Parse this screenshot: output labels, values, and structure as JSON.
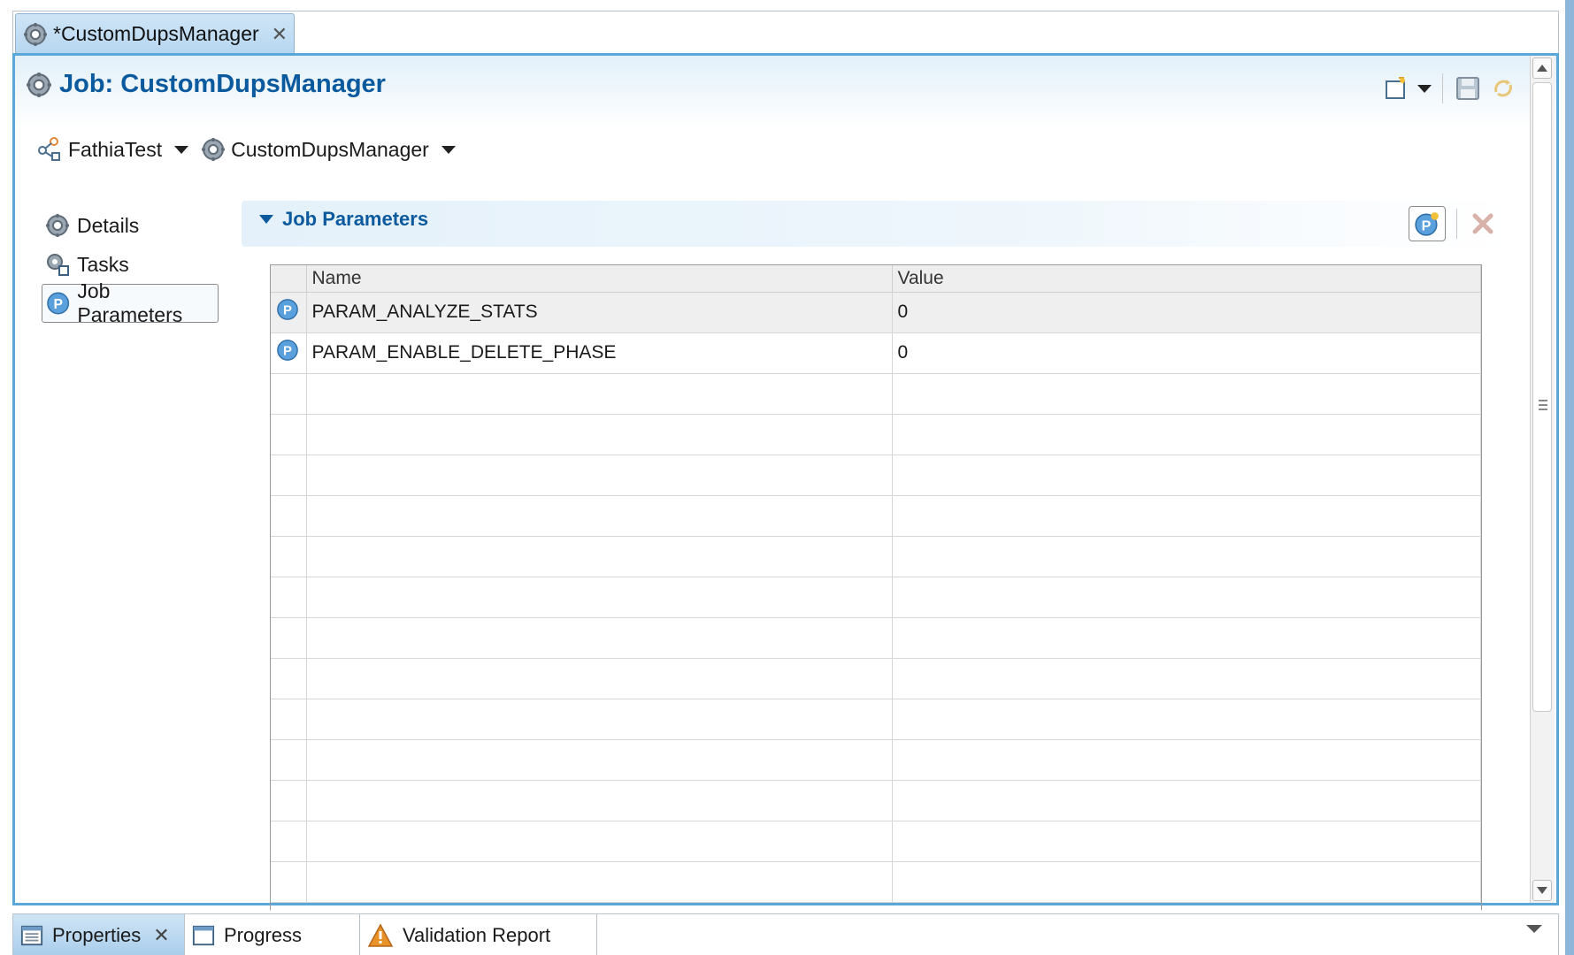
{
  "editor_tab": {
    "title": "*CustomDupsManager",
    "icon": "gear-icon"
  },
  "header": {
    "title": "Job: CustomDupsManager"
  },
  "breadcrumb": [
    {
      "label": "FathiaTest",
      "icon": "project-icon"
    },
    {
      "label": "CustomDupsManager",
      "icon": "gear-icon"
    }
  ],
  "nav": {
    "items": [
      {
        "label": "Details",
        "icon": "gear-icon"
      },
      {
        "label": "Tasks",
        "icon": "tasks-icon"
      },
      {
        "label": "Job Parameters",
        "icon": "parameter-icon",
        "selected": true
      }
    ]
  },
  "section": {
    "title": "Job Parameters"
  },
  "table": {
    "columns": [
      "Name",
      "Value"
    ],
    "rows": [
      {
        "name": "PARAM_ANALYZE_STATS",
        "value": "0"
      },
      {
        "name": "PARAM_ENABLE_DELETE_PHASE",
        "value": "0"
      }
    ],
    "empty_rows": 13
  },
  "bottom_tabs": [
    {
      "label": "Properties",
      "icon": "properties-icon",
      "active": true
    },
    {
      "label": "Progress",
      "icon": "progress-icon"
    },
    {
      "label": "Validation Report",
      "icon": "warning-icon"
    }
  ],
  "colors": {
    "accent": "#0c5a9e",
    "border": "#5aa7d8",
    "tab_active": "#b6d6f0"
  }
}
